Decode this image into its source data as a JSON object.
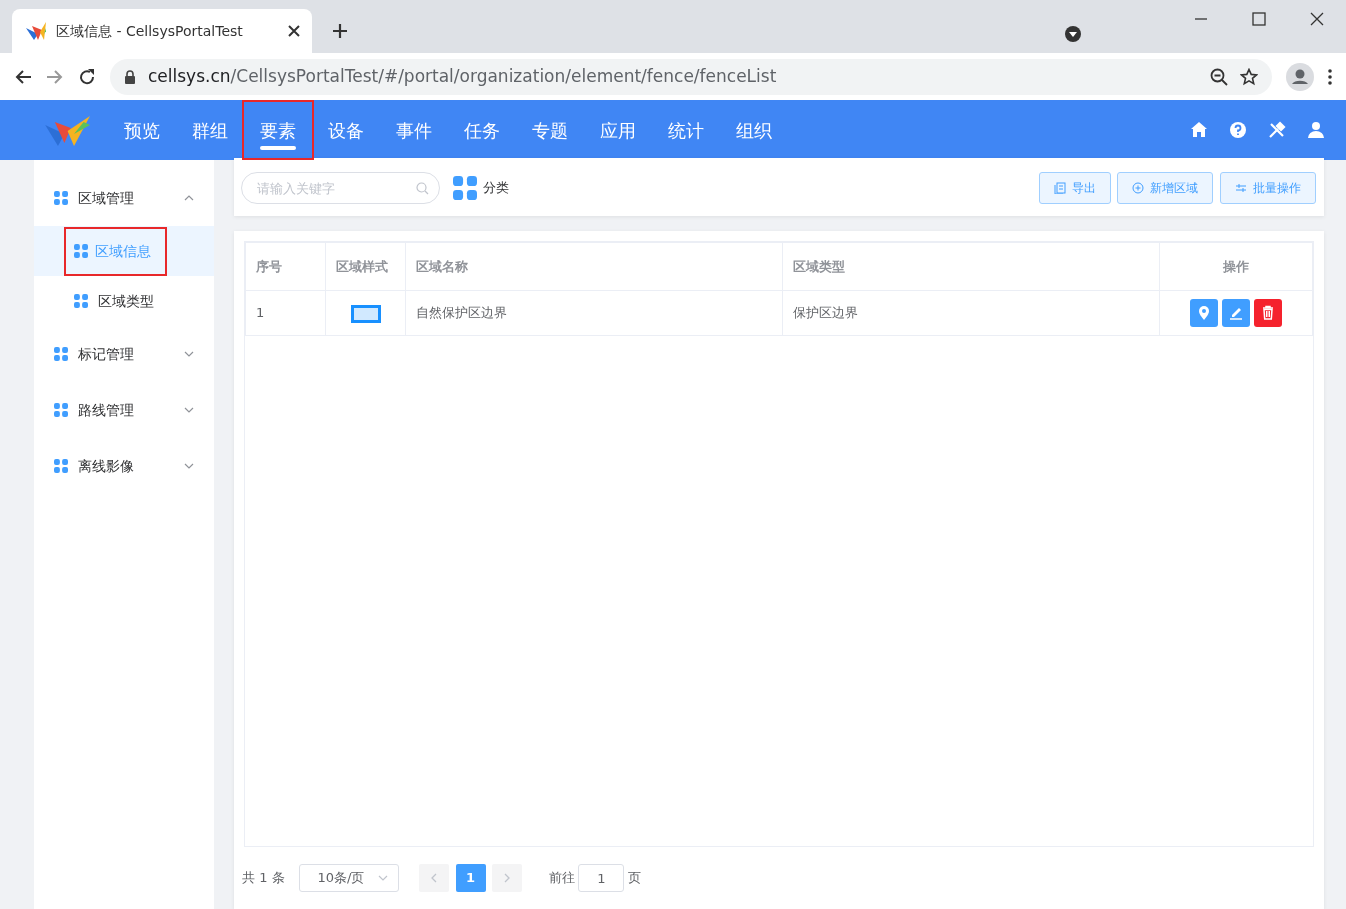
{
  "browser": {
    "tab_title": "区域信息 - CellsysPortalTest",
    "url_host": "cellsys.cn",
    "url_path": "/CellsysPortalTest/#/portal/organization/element/fence/fenceList"
  },
  "nav": [
    {
      "label": "预览",
      "selected": false,
      "highlighted": false
    },
    {
      "label": "群组",
      "selected": false,
      "highlighted": false
    },
    {
      "label": "要素",
      "selected": true,
      "highlighted": true
    },
    {
      "label": "设备",
      "selected": false,
      "highlighted": false
    },
    {
      "label": "事件",
      "selected": false,
      "highlighted": false
    },
    {
      "label": "任务",
      "selected": false,
      "highlighted": false
    },
    {
      "label": "专题",
      "selected": false,
      "highlighted": false
    },
    {
      "label": "应用",
      "selected": false,
      "highlighted": false
    },
    {
      "label": "统计",
      "selected": false,
      "highlighted": false
    },
    {
      "label": "组织",
      "selected": false,
      "highlighted": false
    }
  ],
  "sidebar": [
    {
      "label": "区域管理",
      "expanded": true,
      "children": [
        {
          "label": "区域信息",
          "selected": true,
          "highlighted": true
        },
        {
          "label": "区域类型",
          "selected": false,
          "highlighted": false
        }
      ]
    },
    {
      "label": "标记管理",
      "expanded": false
    },
    {
      "label": "路线管理",
      "expanded": false
    },
    {
      "label": "离线影像",
      "expanded": false
    }
  ],
  "toolbar": {
    "search": {
      "placeholder": "请输入关键字"
    },
    "category": "分类",
    "buttons": [
      {
        "kind": "export",
        "label": "导出"
      },
      {
        "kind": "add",
        "label": "新增区域"
      },
      {
        "kind": "batch",
        "label": "批量操作"
      }
    ]
  },
  "table": {
    "columns": [
      "序号",
      "区域样式",
      "区域名称",
      "区域类型",
      "操作"
    ],
    "rows": [
      {
        "index": "1",
        "name": "自然保护区边界",
        "type": "保护区边界",
        "actions": [
          {
            "kind": "locate"
          },
          {
            "kind": "edit"
          },
          {
            "kind": "delete"
          }
        ]
      }
    ]
  },
  "pagination": {
    "total": "共 1 条",
    "page_size": "10条/页",
    "pages": [
      {
        "label": "1",
        "selected": true
      }
    ],
    "goto_label": "前往",
    "goto_value": "1",
    "page_suffix": "页"
  }
}
